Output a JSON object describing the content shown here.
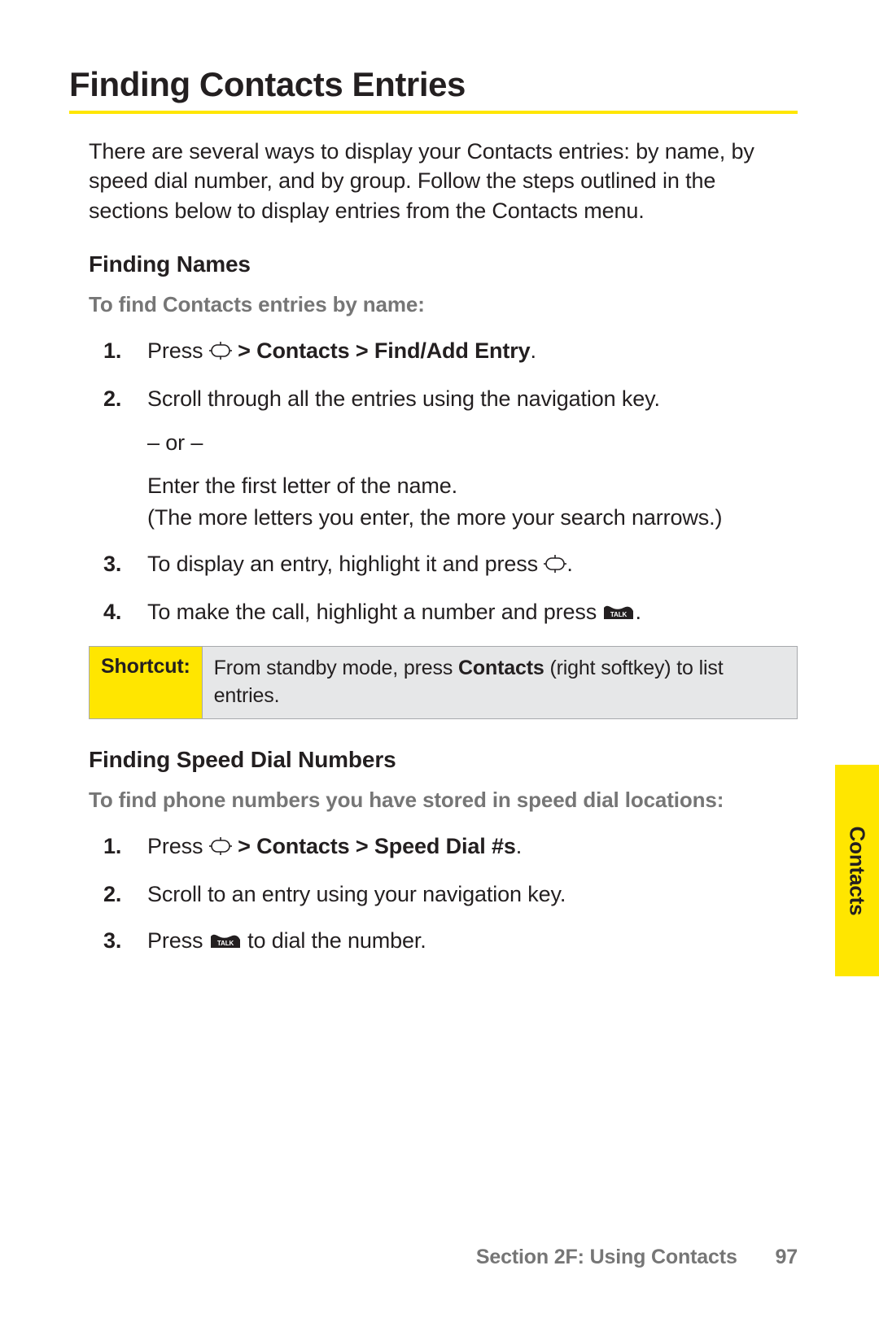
{
  "title": "Finding Contacts Entries",
  "intro": "There are several ways to display your Contacts entries: by name, by speed dial number, and by group. Follow the steps outlined in the sections below to display entries from the Contacts menu.",
  "section1": {
    "heading": "Finding Names",
    "lead": "To find Contacts entries by name:",
    "steps": {
      "s1_pre": "Press ",
      "s1_bold": " > Contacts > Find/Add Entry",
      "s1_post": ".",
      "s2_a": "Scroll through all the entries using the navigation key.",
      "s2_or": "– or –",
      "s2_b": "Enter the first letter of the name.",
      "s2_c": "(The more letters you enter, the more your search narrows.)",
      "s3_pre": "To display an entry, highlight it and press ",
      "s3_post": ".",
      "s4_pre": "To make the call, highlight a number and press ",
      "s4_post": "."
    }
  },
  "shortcut": {
    "label": "Shortcut:",
    "pre": "From standby mode, press ",
    "bold": "Contacts",
    "post": " (right softkey) to list entries."
  },
  "section2": {
    "heading": "Finding Speed Dial Numbers",
    "lead": "To find phone numbers you have stored in speed dial locations:",
    "steps": {
      "s1_pre": "Press ",
      "s1_bold": " > Contacts > Speed Dial #s",
      "s1_post": ".",
      "s2": "Scroll to an entry using your navigation key.",
      "s3_pre": "Press ",
      "s3_post": " to dial the number."
    }
  },
  "footer": {
    "section": "Section 2F: Using Contacts",
    "page": "97"
  },
  "tab": "Contacts"
}
